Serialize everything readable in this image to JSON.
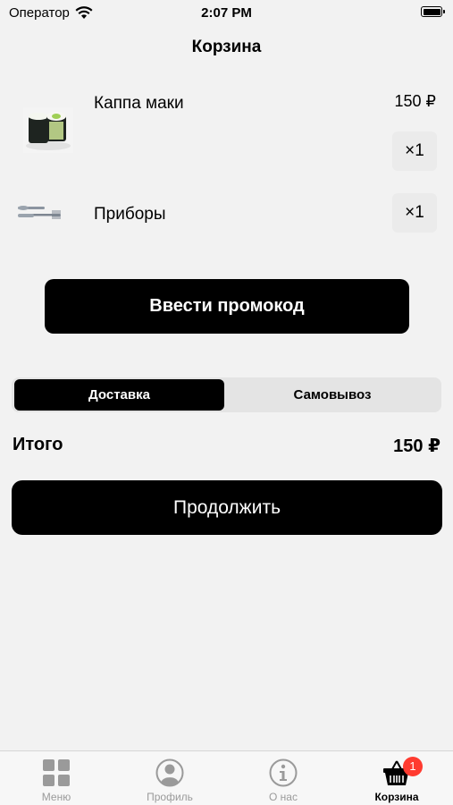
{
  "status_bar": {
    "carrier": "Оператор",
    "time": "2:07 PM"
  },
  "nav": {
    "title": "Корзина"
  },
  "cart_items": [
    {
      "name": "Каппа маки",
      "price": "150 ₽",
      "quantity": "×1",
      "image_icon": "sushi-roll-photo"
    },
    {
      "name": "Приборы",
      "quantity": "×1",
      "image_icon": "cutlery-photo"
    }
  ],
  "promo_button": "Ввести промокод",
  "delivery_toggle": {
    "options": [
      "Доставка",
      "Самовывоз"
    ],
    "selected": "Доставка"
  },
  "total": {
    "label": "Итого",
    "value": "150 ₽"
  },
  "continue_button": "Продолжить",
  "tab_bar": {
    "tabs": [
      {
        "label": "Меню",
        "icon": "grid-icon"
      },
      {
        "label": "Профиль",
        "icon": "person-icon"
      },
      {
        "label": "О нас",
        "icon": "info-icon"
      },
      {
        "label": "Корзина",
        "icon": "basket-icon",
        "badge": "1"
      }
    ],
    "active": "Корзина"
  },
  "colors": {
    "background": "#f2f2f2",
    "button": "#000000",
    "badge": "#ff3b30",
    "tab_inactive": "#9a9a9a"
  }
}
